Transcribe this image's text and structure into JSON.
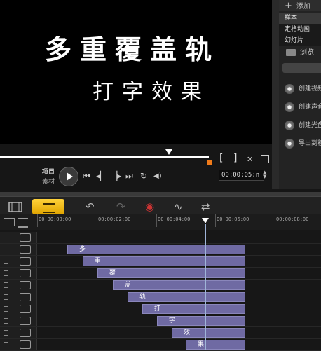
{
  "preview": {
    "overlay_line1": "多重覆盖轨",
    "overlay_line2": "打字效果"
  },
  "right_panel": {
    "top_label": "添加",
    "items": [
      "样本",
      "定格动画",
      "幻灯片"
    ],
    "browse_label": "浏览",
    "actions": [
      "创建视频文件",
      "创建声音文件",
      "创建光盘",
      "导出到移动设备"
    ]
  },
  "transport": {
    "mode_project": "项目",
    "mode_material": "素材",
    "bracket_in": "[",
    "bracket_out": "]",
    "cut_symbol": "✕",
    "prev_symbol": "⏮",
    "stepback_symbol": "◂▏",
    "stepfwd_symbol": "▕▸",
    "next_symbol": "⏭",
    "repeat_symbol": "↻",
    "volume_symbol": "◀)",
    "timecode": "00:00:05:",
    "timecode_unit": "n"
  },
  "toolbar": {
    "undo_symbol": "↶",
    "redo_symbol": "↷",
    "record_symbol": "◉",
    "audio_symbol": "∿",
    "mix_symbol": "⇄"
  },
  "ruler": {
    "labels": [
      "00:00:00:00",
      "00:00:02:00",
      "00:00:04:00",
      "00:00:06:00",
      "00:00:08:00"
    ]
  },
  "tracks": {
    "clips": [
      "多",
      "重",
      "覆",
      "盖",
      "轨",
      "打",
      "字",
      "效",
      "果"
    ]
  },
  "colors": {
    "accent_orange": "#f07b1a",
    "timeline_button": "#f5c32c",
    "clip": "#6f6aa3"
  }
}
